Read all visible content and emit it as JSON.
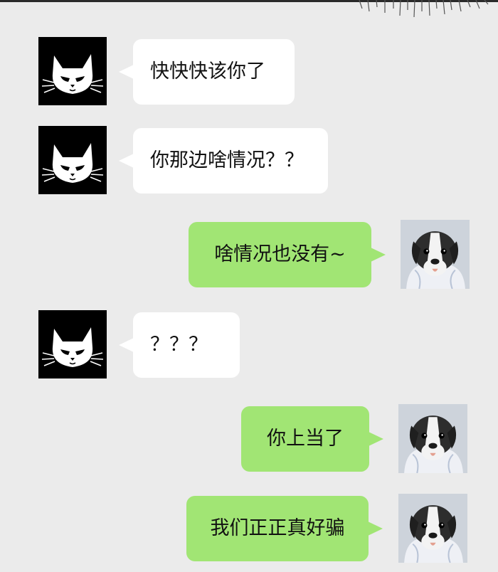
{
  "messages": [
    {
      "side": "left",
      "sender": "cat",
      "text": "快快快该你了"
    },
    {
      "side": "left",
      "sender": "cat",
      "text": "你那边啥情况？？"
    },
    {
      "side": "right",
      "sender": "dog",
      "text": "啥情况也没有~"
    },
    {
      "side": "left",
      "sender": "cat",
      "text": "？？？"
    },
    {
      "side": "right",
      "sender": "dog",
      "text": "你上当了"
    },
    {
      "side": "right",
      "sender": "dog",
      "text": "我们正正真好骗"
    }
  ],
  "colors": {
    "background": "#ebebeb",
    "incoming_bubble": "#ffffff",
    "outgoing_bubble": "#a1e574",
    "cat_avatar_bg": "#000000"
  },
  "icons": {
    "cat": "cat-face-icon",
    "dog": "dog-avatar"
  }
}
